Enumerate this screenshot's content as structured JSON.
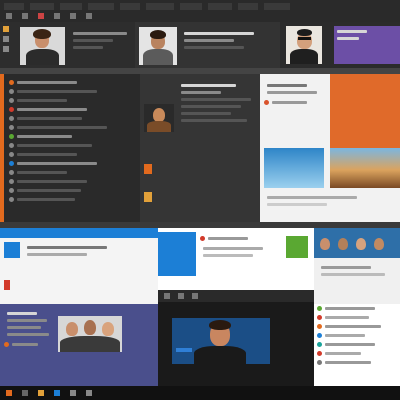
{
  "top_strip": {
    "tabs": [
      "",
      "",
      "",
      "",
      "",
      "",
      "",
      "",
      "",
      "",
      "",
      ""
    ],
    "label_right": ""
  },
  "collage": {
    "panels": [
      {
        "id": "top-left-call",
        "accent": "#2a2a2a"
      },
      {
        "id": "top-center-call",
        "accent": "#2f2f2f"
      },
      {
        "id": "top-right-call",
        "accent": "#6b4aa0"
      },
      {
        "id": "left-dark-sidebar",
        "accent": "#2b2b2b"
      },
      {
        "id": "center-media-list",
        "accent": "#333333"
      },
      {
        "id": "right-feed-orange",
        "accent": "#d9532c"
      },
      {
        "id": "bottom-left-blue",
        "accent": "#1a7bd3"
      },
      {
        "id": "bottom-center-video",
        "accent": "#0f0f0f"
      },
      {
        "id": "bottom-right-list",
        "accent": "#ffffff"
      }
    ],
    "colors": {
      "orange": "#e26a1e",
      "blue": "#1c7fd6",
      "purple": "#6c4fa6",
      "green": "#5aa832",
      "dark": "#262626",
      "red": "#d23a2a"
    },
    "icons": [
      "play-icon",
      "phone-icon",
      "video-icon",
      "chat-icon",
      "user-icon",
      "settings-icon"
    ]
  },
  "taskbar": {
    "icons": [
      "start-icon",
      "search-icon",
      "folder-icon",
      "browser-icon",
      "mail-icon",
      "store-icon"
    ]
  }
}
